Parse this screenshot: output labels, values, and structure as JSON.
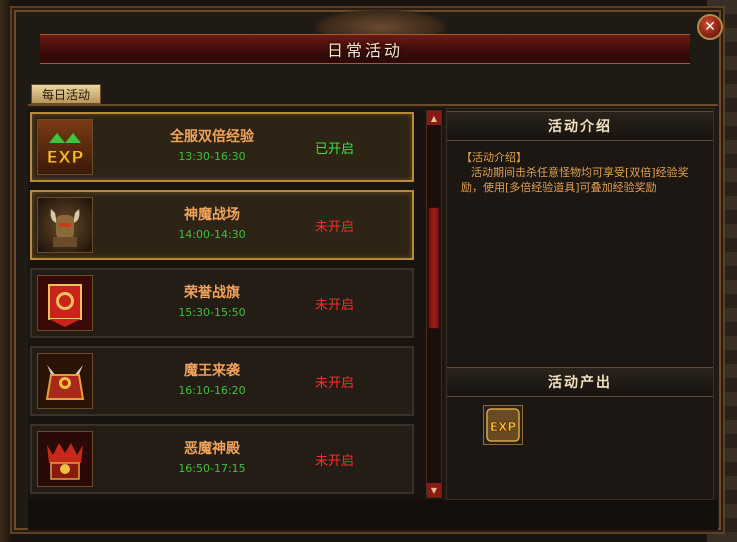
{
  "window": {
    "title": "日常活动",
    "close_label": "✕"
  },
  "tabs": [
    {
      "label": "每日活动"
    }
  ],
  "activities": [
    {
      "name": "全服双倍经验",
      "time": "13:30-16:30",
      "status": "已开启",
      "icon": "exp-icon"
    },
    {
      "name": "神魔战场",
      "time": "14:00-14:30",
      "status": "未开启",
      "icon": "demon-warrior-icon"
    },
    {
      "name": "荣誉战旗",
      "time": "15:30-15:50",
      "status": "未开启",
      "icon": "honor-banner-icon"
    },
    {
      "name": "魔王来袭",
      "time": "16:10-16:20",
      "status": "未开启",
      "icon": "demon-king-icon"
    },
    {
      "name": "恶魔神殿",
      "time": "16:50-17:15",
      "status": "未开启",
      "icon": "demon-temple-icon"
    }
  ],
  "intro": {
    "heading": "活动介绍",
    "label": "【活动介绍】",
    "text": "活动期间击杀任意怪物均可享受[双倍]经验奖励，使用[多倍经验道具]可叠加经验奖励"
  },
  "output": {
    "heading": "活动产出",
    "item_label": "EXP"
  },
  "colors": {
    "status_open": "#3fe03f",
    "status_closed": "#ff2a2a",
    "name": "#f0a25a",
    "time": "#3fbf3f"
  }
}
